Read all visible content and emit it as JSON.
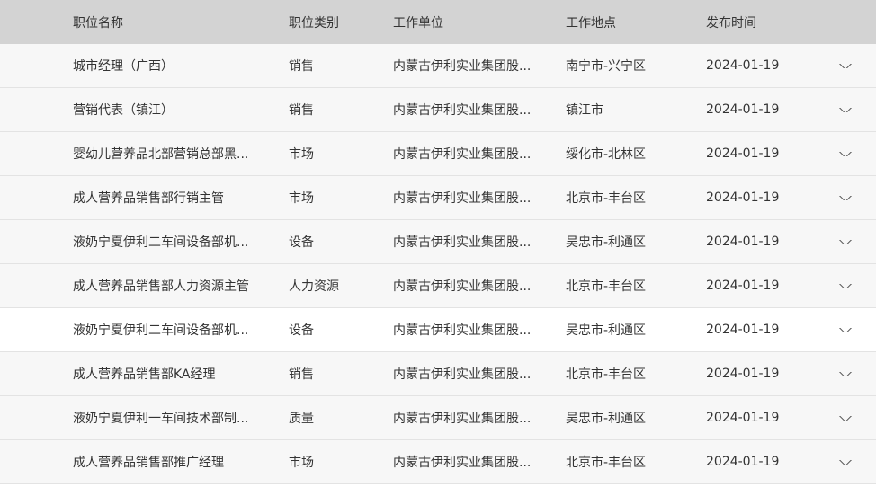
{
  "header": {
    "name": "职位名称",
    "category": "职位类别",
    "unit": "工作单位",
    "location": "工作地点",
    "date": "发布时间"
  },
  "rows": [
    {
      "name": "城市经理（广西）",
      "category": "销售",
      "unit": "内蒙古伊利实业集团股...",
      "location": "南宁市-兴宁区",
      "date": "2024-01-19"
    },
    {
      "name": "营销代表（镇江）",
      "category": "销售",
      "unit": "内蒙古伊利实业集团股...",
      "location": "镇江市",
      "date": "2024-01-19"
    },
    {
      "name": "婴幼儿营养品北部营销总部黑...",
      "category": "市场",
      "unit": "内蒙古伊利实业集团股...",
      "location": "绥化市-北林区",
      "date": "2024-01-19"
    },
    {
      "name": "成人营养品销售部行销主管",
      "category": "市场",
      "unit": "内蒙古伊利实业集团股...",
      "location": "北京市-丰台区",
      "date": "2024-01-19"
    },
    {
      "name": "液奶宁夏伊利二车间设备部机...",
      "category": "设备",
      "unit": "内蒙古伊利实业集团股...",
      "location": "吴忠市-利通区",
      "date": "2024-01-19"
    },
    {
      "name": "成人营养品销售部人力资源主管",
      "category": "人力资源",
      "unit": "内蒙古伊利实业集团股...",
      "location": "北京市-丰台区",
      "date": "2024-01-19"
    },
    {
      "name": "液奶宁夏伊利二车间设备部机...",
      "category": "设备",
      "unit": "内蒙古伊利实业集团股...",
      "location": "吴忠市-利通区",
      "date": "2024-01-19"
    },
    {
      "name": "成人营养品销售部KA经理",
      "category": "销售",
      "unit": "内蒙古伊利实业集团股...",
      "location": "北京市-丰台区",
      "date": "2024-01-19"
    },
    {
      "name": "液奶宁夏伊利一车间技术部制...",
      "category": "质量",
      "unit": "内蒙古伊利实业集团股...",
      "location": "吴忠市-利通区",
      "date": "2024-01-19"
    },
    {
      "name": "成人营养品销售部推广经理",
      "category": "市场",
      "unit": "内蒙古伊利实业集团股...",
      "location": "北京市-丰台区",
      "date": "2024-01-19"
    }
  ],
  "icons": {
    "row_toggle": "chevron-down-icon"
  },
  "colors": {
    "header_bg": "#d3d3d3",
    "row_bg": "#f7f7f7",
    "highlight_row_bg": "#ffffff",
    "text": "#333333"
  }
}
